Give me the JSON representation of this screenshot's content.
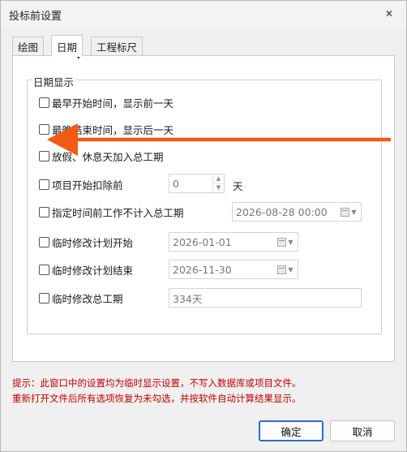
{
  "window": {
    "title": "投标前设置",
    "close_glyph": "✕"
  },
  "tabs": [
    {
      "label": "绘图"
    },
    {
      "label": "日期"
    },
    {
      "label": "工程标尺"
    }
  ],
  "group": {
    "legend": "日期显示",
    "options": [
      {
        "label": "最早开始时间，显示前一天",
        "checked": false
      },
      {
        "label": "最晚结束时间，显示后一天",
        "checked": false
      },
      {
        "label": "放假、休息天加入总工期",
        "checked": false
      },
      {
        "label": "项目开始扣除前",
        "checked": false
      },
      {
        "label": "指定时间前工作不计入总工期",
        "checked": false
      },
      {
        "label": "临时修改计划开始",
        "checked": false
      },
      {
        "label": "临时修改计划结束",
        "checked": false
      },
      {
        "label": "临时修改总工期",
        "checked": false
      }
    ],
    "deduct_days": {
      "value": "0",
      "unit": "天"
    },
    "cutoff_datetime": "2026-08-28 00:00",
    "plan_start": "2026-01-01",
    "plan_end": "2026-11-30",
    "total_duration": "334天"
  },
  "hint": {
    "line1": "提示：此窗口中的设置均为临时显示设置，不写入数据库或项目文件。",
    "line2": "重新打开文件后所有选项恢复为未勾选，并按软件自动计算结果显示。"
  },
  "buttons": {
    "ok": "确定",
    "cancel": "取消"
  },
  "colors": {
    "annotation_arrow": "#f25a14",
    "hint_text": "#c00000",
    "primary_border": "#2d6fc8"
  }
}
